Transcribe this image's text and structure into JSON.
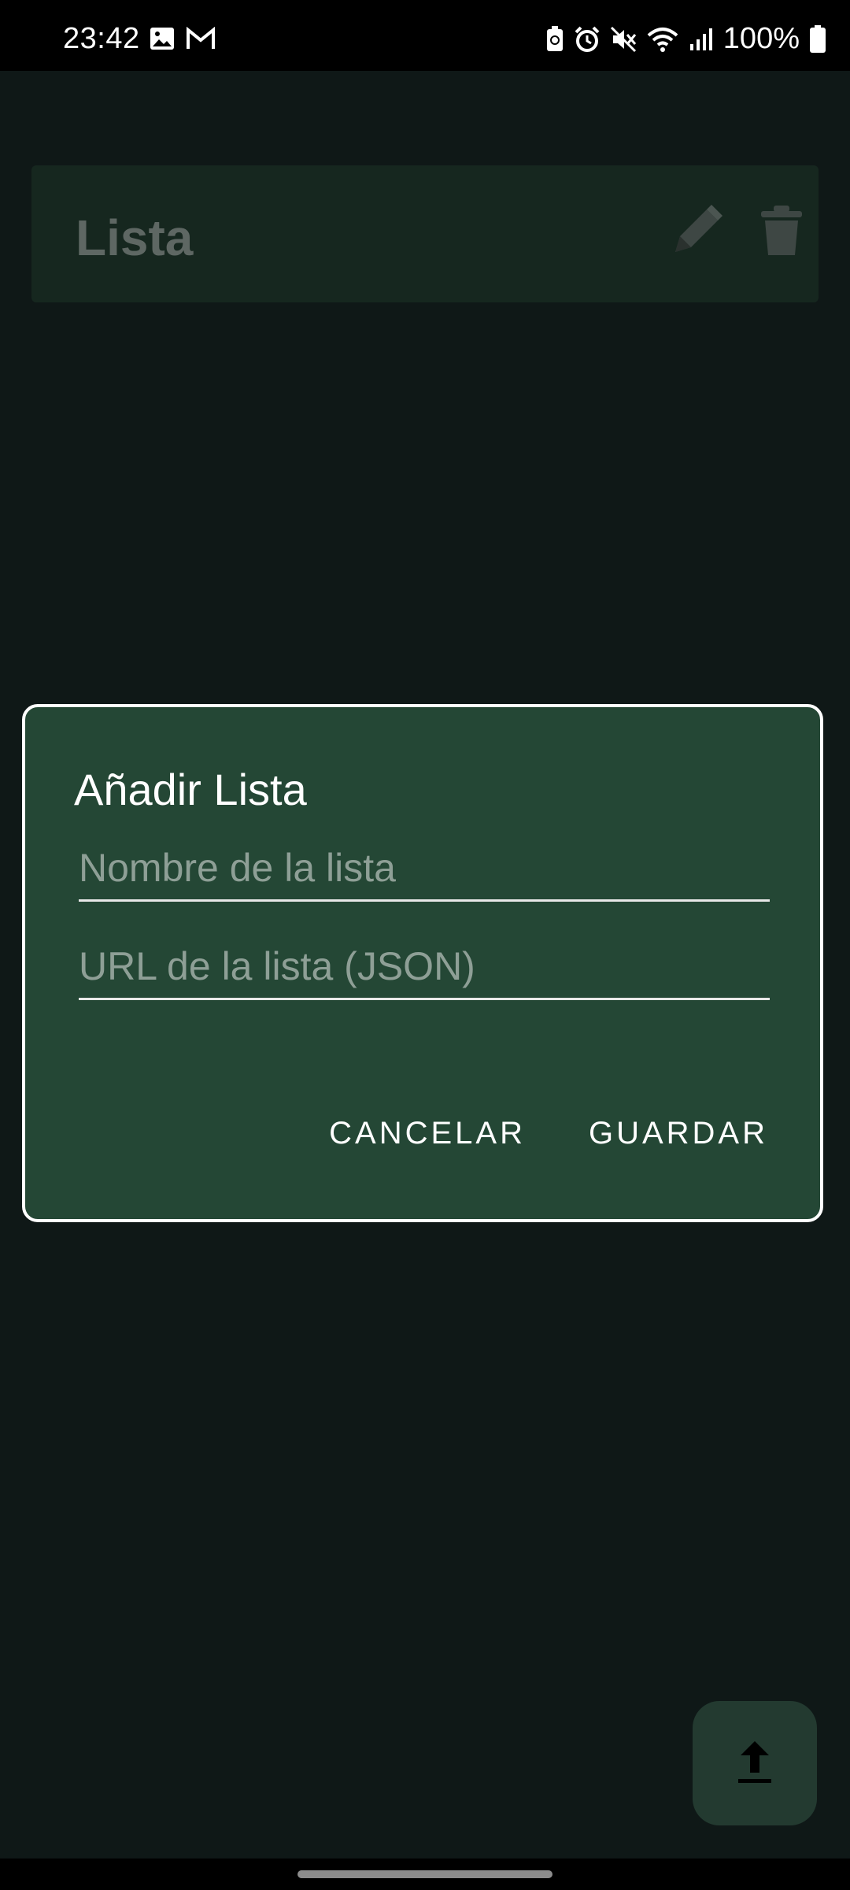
{
  "status_bar": {
    "time": "23:42",
    "battery": "100%",
    "left_icons": [
      "image-icon",
      "gmail-icon"
    ],
    "right_icons": [
      "battery-saver-icon",
      "alarm-icon",
      "mute-icon",
      "wifi-icon",
      "signal-icon",
      "battery-icon"
    ]
  },
  "list_card": {
    "title": "Lista",
    "edit_icon": "pencil-icon",
    "delete_icon": "trash-icon"
  },
  "fab": {
    "icon": "upload-icon"
  },
  "dialog": {
    "title": "Añadir Lista",
    "name_placeholder": "Nombre de la lista",
    "name_value": "",
    "url_placeholder": "URL de la lista (JSON)",
    "url_value": "",
    "cancel_label": "CANCELAR",
    "save_label": "GUARDAR"
  },
  "colors": {
    "background": "#0f1817",
    "card": "#16271f",
    "dialog": "#244735",
    "fab": "#233a30",
    "placeholder": "#8e9f96"
  }
}
